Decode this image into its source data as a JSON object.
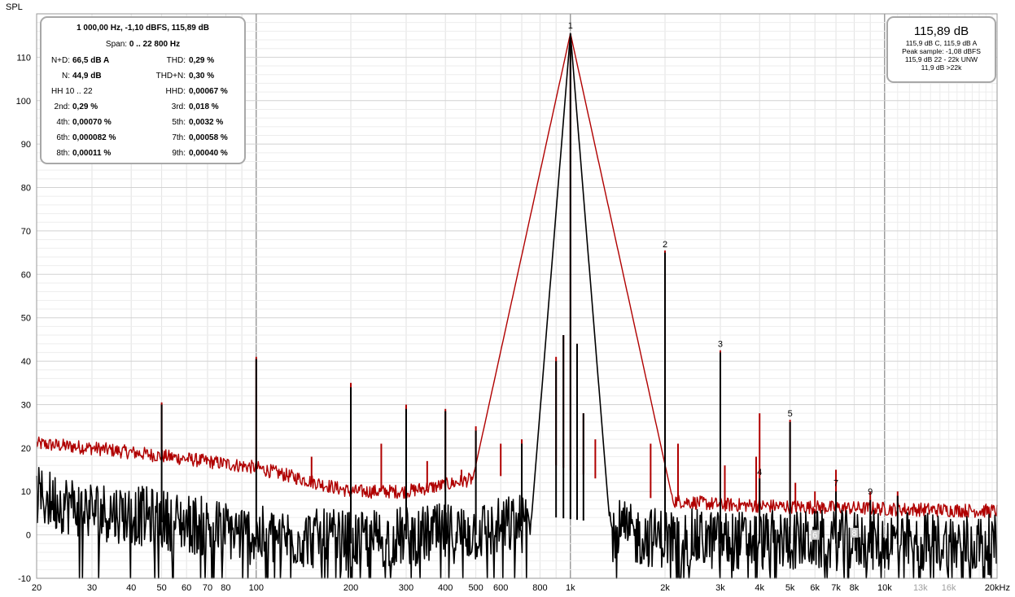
{
  "chart_data": {
    "type": "line",
    "ylabel": "SPL",
    "x_scale": "log",
    "xlim": [
      20,
      22800
    ],
    "ylim": [
      -10,
      120
    ],
    "grid": true,
    "x_ticks": [
      {
        "v": 20,
        "t": "20"
      },
      {
        "v": 30,
        "t": "30"
      },
      {
        "v": 40,
        "t": "40"
      },
      {
        "v": 50,
        "t": "50"
      },
      {
        "v": 60,
        "t": "60"
      },
      {
        "v": 70,
        "t": "70"
      },
      {
        "v": 80,
        "t": "80"
      },
      {
        "v": 100,
        "t": "100"
      },
      {
        "v": 200,
        "t": "200"
      },
      {
        "v": 300,
        "t": "300"
      },
      {
        "v": 400,
        "t": "400"
      },
      {
        "v": 500,
        "t": "500"
      },
      {
        "v": 600,
        "t": "600"
      },
      {
        "v": 800,
        "t": "800"
      },
      {
        "v": 1000,
        "t": "1k"
      },
      {
        "v": 2000,
        "t": "2k"
      },
      {
        "v": 3000,
        "t": "3k"
      },
      {
        "v": 4000,
        "t": "4k"
      },
      {
        "v": 5000,
        "t": "5k"
      },
      {
        "v": 6000,
        "t": "6k"
      },
      {
        "v": 7000,
        "t": "7k"
      },
      {
        "v": 8000,
        "t": "8k"
      },
      {
        "v": 10000,
        "t": "10k"
      },
      {
        "v": 13000,
        "t": "13k"
      },
      {
        "v": 16000,
        "t": "16k"
      },
      {
        "v": 20000,
        "t": "20kHz"
      }
    ],
    "y_ticks": [
      110,
      100,
      90,
      80,
      70,
      60,
      50,
      40,
      30,
      20,
      10,
      0,
      -10
    ],
    "series": [
      {
        "color": "#b00000",
        "noise_floor": [
          [
            20,
            21
          ],
          [
            30,
            20
          ],
          [
            40,
            19
          ],
          [
            60,
            17.5
          ],
          [
            100,
            15.5
          ],
          [
            200,
            10
          ],
          [
            300,
            10
          ],
          [
            400,
            11.5
          ],
          [
            500,
            13
          ],
          [
            700,
            14
          ],
          [
            900,
            16
          ],
          [
            1200,
            13
          ],
          [
            1600,
            9
          ],
          [
            2000,
            8
          ],
          [
            3000,
            7
          ],
          [
            5000,
            6.5
          ],
          [
            10000,
            6
          ],
          [
            22800,
            5.5
          ]
        ],
        "peaks": [
          [
            50,
            30.5
          ],
          [
            100,
            41
          ],
          [
            150,
            18
          ],
          [
            200,
            35
          ],
          [
            250,
            21
          ],
          [
            300,
            30
          ],
          [
            350,
            17
          ],
          [
            400,
            29
          ],
          [
            450,
            15
          ],
          [
            500,
            25
          ],
          [
            600,
            21
          ],
          [
            700,
            22
          ],
          [
            900,
            41
          ],
          [
            950,
            46
          ],
          [
            1000,
            115.5
          ],
          [
            1050,
            44
          ],
          [
            1100,
            28
          ],
          [
            1200,
            22
          ],
          [
            1800,
            21
          ],
          [
            2000,
            65.5
          ],
          [
            2200,
            21
          ],
          [
            3000,
            42.5
          ],
          [
            3100,
            16
          ],
          [
            3900,
            18
          ],
          [
            4000,
            28
          ],
          [
            5000,
            26.5
          ],
          [
            5200,
            12
          ],
          [
            6000,
            10
          ],
          [
            7000,
            15
          ],
          [
            9000,
            10
          ],
          [
            11000,
            10
          ]
        ]
      },
      {
        "color": "#000000",
        "noise_floor": [
          [
            20,
            8
          ],
          [
            30,
            5
          ],
          [
            40,
            4
          ],
          [
            60,
            2
          ],
          [
            100,
            -1
          ],
          [
            200,
            -2
          ],
          [
            300,
            -1
          ],
          [
            500,
            0
          ],
          [
            700,
            2
          ],
          [
            900,
            4
          ],
          [
            1200,
            3
          ],
          [
            1600,
            -1
          ],
          [
            3000,
            -2
          ],
          [
            10000,
            -2
          ],
          [
            22800,
            -3
          ]
        ],
        "peaks": [
          [
            50,
            30
          ],
          [
            100,
            40.5
          ],
          [
            200,
            34
          ],
          [
            300,
            29
          ],
          [
            400,
            28.5
          ],
          [
            500,
            24
          ],
          [
            700,
            21
          ],
          [
            900,
            40
          ],
          [
            950,
            46
          ],
          [
            1000,
            115.5
          ],
          [
            1050,
            44
          ],
          [
            1100,
            28
          ],
          [
            2000,
            65
          ],
          [
            3000,
            42
          ],
          [
            4000,
            13
          ],
          [
            5000,
            26
          ],
          [
            7000,
            10
          ],
          [
            9000,
            8
          ],
          [
            11000,
            9
          ]
        ]
      }
    ],
    "harmonic_markers": [
      {
        "label": "1",
        "f": 1000,
        "db": 115.9
      },
      {
        "label": "2",
        "f": 2000,
        "db": 65.5
      },
      {
        "label": "3",
        "f": 3000,
        "db": 42.5
      },
      {
        "label": "4",
        "f": 4000,
        "db": 13
      },
      {
        "label": "5",
        "f": 5000,
        "db": 26.5
      },
      {
        "label": "6",
        "f": 6000,
        "db": -1.5,
        "boxed": true
      },
      {
        "label": "7",
        "f": 7000,
        "db": 10.5
      },
      {
        "label": "8",
        "f": 8000,
        "db": -1,
        "boxed": true
      },
      {
        "label": "9",
        "f": 9000,
        "db": 8.5
      }
    ]
  },
  "distortion_panel": {
    "title": "1 000,00 Hz, -1,10 dBFS, 115,89 dB",
    "span_label": "Span:",
    "span_value": "0 .. 22 800 Hz",
    "rows": [
      {
        "l1": "N+D:",
        "v1": "66,5 dB A",
        "l2": "THD:",
        "v2": "0,29 %"
      },
      {
        "l1": "N:",
        "v1": "44,9 dB",
        "l2": "THD+N:",
        "v2": "0,30 %"
      },
      {
        "l1": "HH 10 .. 22",
        "v1": "",
        "l2": "HHD:",
        "v2": "0,00067 %"
      },
      {
        "l1": "2nd:",
        "v1": "0,29 %",
        "l2": "3rd:",
        "v2": "0,018 %"
      },
      {
        "l1": "4th:",
        "v1": "0,00070 %",
        "l2": "5th:",
        "v2": "0,0032 %"
      },
      {
        "l1": "6th:",
        "v1": "0,000082 %",
        "l2": "7th:",
        "v2": "0,00058 %"
      },
      {
        "l1": "8th:",
        "v1": "0,00011 %",
        "l2": "9th:",
        "v2": "0,00040 %"
      }
    ]
  },
  "level_panel": {
    "value": "115,89 dB",
    "line1": "115,9 dB C, 115,9 dB A",
    "line2": "Peak sample: -1,08 dBFS",
    "line3": "115,9 dB 22 - 22k UNW",
    "line4": "11,9 dB >22k"
  }
}
